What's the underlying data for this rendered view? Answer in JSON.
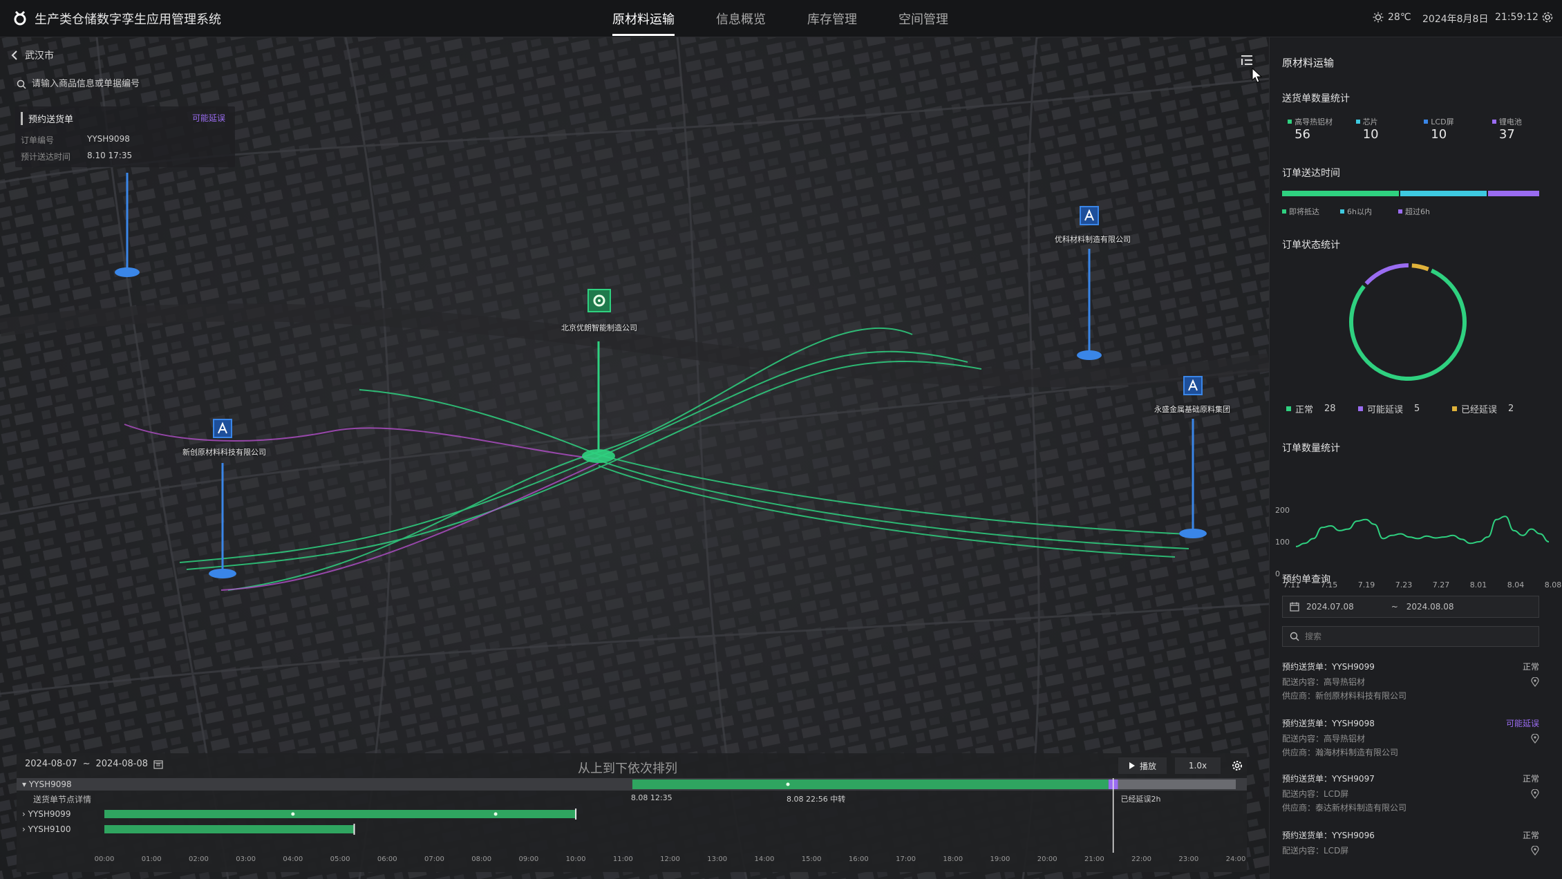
{
  "header": {
    "title": "生产类仓储数字孪生应用管理系统",
    "tabs": [
      {
        "label": "原材料运输",
        "active": true
      },
      {
        "label": "信息概览",
        "active": false
      },
      {
        "label": "库存管理",
        "active": false
      },
      {
        "label": "空间管理",
        "active": false
      }
    ],
    "weather": "28℃",
    "date": "2024年8月8日",
    "time": "21:59:12"
  },
  "left": {
    "city": "武汉市",
    "search_placeholder": "请输入商品信息或单据编号",
    "card": {
      "title": "预约送货单",
      "status": "可能延误",
      "order_label": "订单编号",
      "order_value": "YYSH9098",
      "eta_label": "预计送达时间",
      "eta_value": "8.10 17:35"
    }
  },
  "map": {
    "labels": {
      "center": "北京优朗智能制造公司",
      "left": "新创原材料科技有限公司",
      "right_top": "优科材料制造有限公司",
      "right": "永盛金属基础原料集团"
    },
    "colors": {
      "green": "#2fd180",
      "purple": "#b24fc8",
      "pin_blue": "#3a86e8"
    }
  },
  "panel": {
    "title": "原材料运输",
    "delivery_stats": {
      "title": "送货单数量统计",
      "items": [
        {
          "label": "高导热铝材",
          "value": "56",
          "color": "#2fd180"
        },
        {
          "label": "芯片",
          "value": "10",
          "color": "#3ec9e0"
        },
        {
          "label": "LCD屏",
          "value": "10",
          "color": "#3a86e8"
        },
        {
          "label": "锂电池",
          "value": "37",
          "color": "#9a6cf1"
        }
      ]
    },
    "arrival": {
      "title": "订单送达时间",
      "segments": [
        {
          "label": "即将抵达",
          "fraction": 0.46,
          "color": "#2fd180"
        },
        {
          "label": "6h以内",
          "fraction": 0.34,
          "color": "#3ec9e0"
        },
        {
          "label": "超过6h",
          "fraction": 0.2,
          "color": "#9a6cf1"
        }
      ]
    },
    "status": {
      "title": "订单状态统计",
      "items": [
        {
          "label": "正常",
          "value": 28,
          "color": "#2fd180"
        },
        {
          "label": "可能延误",
          "value": 5,
          "color": "#9a6cf1"
        },
        {
          "label": "已经延误",
          "value": 2,
          "color": "#e0b23a"
        }
      ]
    },
    "order_count_title": "订单数量统计",
    "query": {
      "title": "预约单查询",
      "date_from": "2024.07.08",
      "date_sep": "~",
      "date_to": "2024.08.08",
      "search_placeholder": "搜索",
      "results": [
        {
          "title": "预约送货单：YYSH9099",
          "status": "正常",
          "warn": false,
          "content": "配送内容：高导热铝材",
          "supplier": "供应商：新创原材料科技有限公司"
        },
        {
          "title": "预约送货单：YYSH9098",
          "status": "可能延误",
          "warn": true,
          "content": "配送内容：高导热铝材",
          "supplier": "供应商：瀚海材料制造有限公司"
        },
        {
          "title": "预约送货单：YYSH9097",
          "status": "正常",
          "warn": false,
          "content": "配送内容：LCD屏",
          "supplier": "供应商：泰达新材料制造有限公司"
        },
        {
          "title": "预约送货单：YYSH9096",
          "status": "正常",
          "warn": false,
          "content": "配送内容：LCD屏",
          "supplier": ""
        }
      ]
    }
  },
  "chart_data": {
    "type": "line",
    "title": "订单数量统计",
    "xlabel": "",
    "ylabel": "",
    "ylim": [
      0,
      200
    ],
    "yticks": [
      0,
      100,
      200
    ],
    "xticks": [
      "7.11",
      "7.15",
      "7.19",
      "7.23",
      "7.27",
      "8.01",
      "8.04",
      "8.08"
    ],
    "x_index": [
      0,
      1,
      2,
      3,
      4,
      5,
      6,
      7,
      8,
      9,
      10,
      11,
      12,
      13,
      14,
      15,
      16,
      17,
      18,
      19,
      20,
      21,
      22,
      23,
      24,
      25,
      26,
      27,
      28,
      29
    ],
    "series": [
      {
        "color": "#2fd180",
        "values": [
          85,
          95,
          110,
          145,
          150,
          135,
          140,
          165,
          170,
          155,
          110,
          120,
          125,
          115,
          110,
          118,
          112,
          115,
          120,
          108,
          95,
          100,
          115,
          170,
          180,
          135,
          120,
          140,
          125,
          100
        ]
      }
    ],
    "grid": false,
    "legend": "none"
  },
  "timeline": {
    "date_from": "2024-08-07",
    "date_to": "2024-08-08",
    "caption": "从上到下依次排列",
    "play_label": "播放",
    "speed_label": "1.0x",
    "rows": [
      {
        "label": "YYSH9098",
        "start_h": 11.2,
        "end_h": 21.3,
        "delay_end_h": 21.5,
        "expanded": true
      },
      {
        "label": "YYSH9099",
        "start_h": 0.0,
        "end_h": 10.0,
        "delay_end_h": null,
        "expanded": false
      },
      {
        "label": "YYSH9100",
        "start_h": 0.0,
        "end_h": 5.3,
        "delay_end_h": null,
        "expanded": false
      }
    ],
    "detail_label": "送货单节点详情",
    "detail_notes": [
      {
        "text": "8.08 12:35",
        "hour": 11.2
      },
      {
        "text": "8.08 22:56 中转",
        "hour": 14.5
      },
      {
        "text": "已经延误2h",
        "hour": 21.5
      }
    ],
    "current_hour": 21.4,
    "hours": [
      "00:00",
      "01:00",
      "02:00",
      "03:00",
      "04:00",
      "05:00",
      "06:00",
      "07:00",
      "08:00",
      "09:00",
      "10:00",
      "11:00",
      "12:00",
      "13:00",
      "14:00",
      "15:00",
      "16:00",
      "17:00",
      "18:00",
      "19:00",
      "20:00",
      "21:00",
      "22:00",
      "23:00",
      "24:00"
    ]
  }
}
